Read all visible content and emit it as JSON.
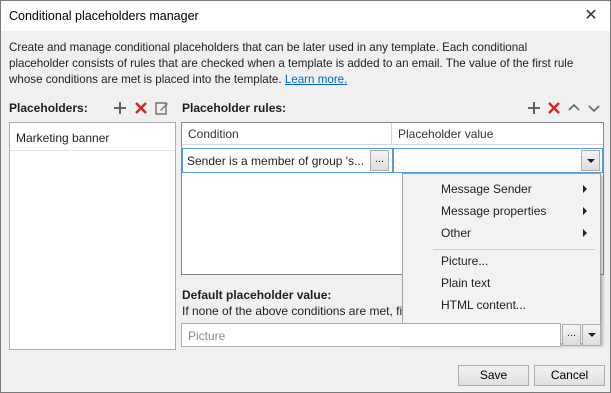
{
  "window": {
    "title": "Conditional placeholders manager",
    "close_glyph": "✕"
  },
  "description": {
    "line1": "Create and manage conditional placeholders that can be later used in any template. Each conditional",
    "line2": "placeholder consists of rules that are checked when a template is added to an email. The value of the first rule",
    "line3": "whose conditions are met is placed into the template.",
    "link": "Learn more."
  },
  "placeholders": {
    "label": "Placeholders:",
    "items": [
      "Marketing banner"
    ],
    "icons": [
      "plus-icon",
      "delete-icon",
      "edit-icon"
    ]
  },
  "rules": {
    "label": "Placeholder rules:",
    "columns": [
      "Condition",
      "Placeholder value"
    ],
    "rows": [
      {
        "condition": "Sender is a member of group 's...",
        "value": ""
      }
    ],
    "browse_label": "...",
    "icons": [
      "plus-icon",
      "delete-icon",
      "move-up-icon",
      "move-down-icon"
    ]
  },
  "context_menu": {
    "items": [
      {
        "label": "Message Sender",
        "submenu": true
      },
      {
        "label": "Message properties",
        "submenu": true
      },
      {
        "label": "Other",
        "submenu": true
      },
      {
        "label": "Picture...",
        "submenu": false
      },
      {
        "label": "Plain text",
        "submenu": false
      },
      {
        "label": "HTML content...",
        "submenu": false
      }
    ]
  },
  "default_value": {
    "label": "Default placeholder value:",
    "hint": "If none of the above conditions are met, fi",
    "placeholder": "Picture",
    "browse_label": "..."
  },
  "buttons": {
    "save": "Save",
    "cancel": "Cancel"
  },
  "colors": {
    "accent_link": "#0066cc",
    "plus": "#555555",
    "delete": "#d42525",
    "selection_border": "#569de5"
  }
}
